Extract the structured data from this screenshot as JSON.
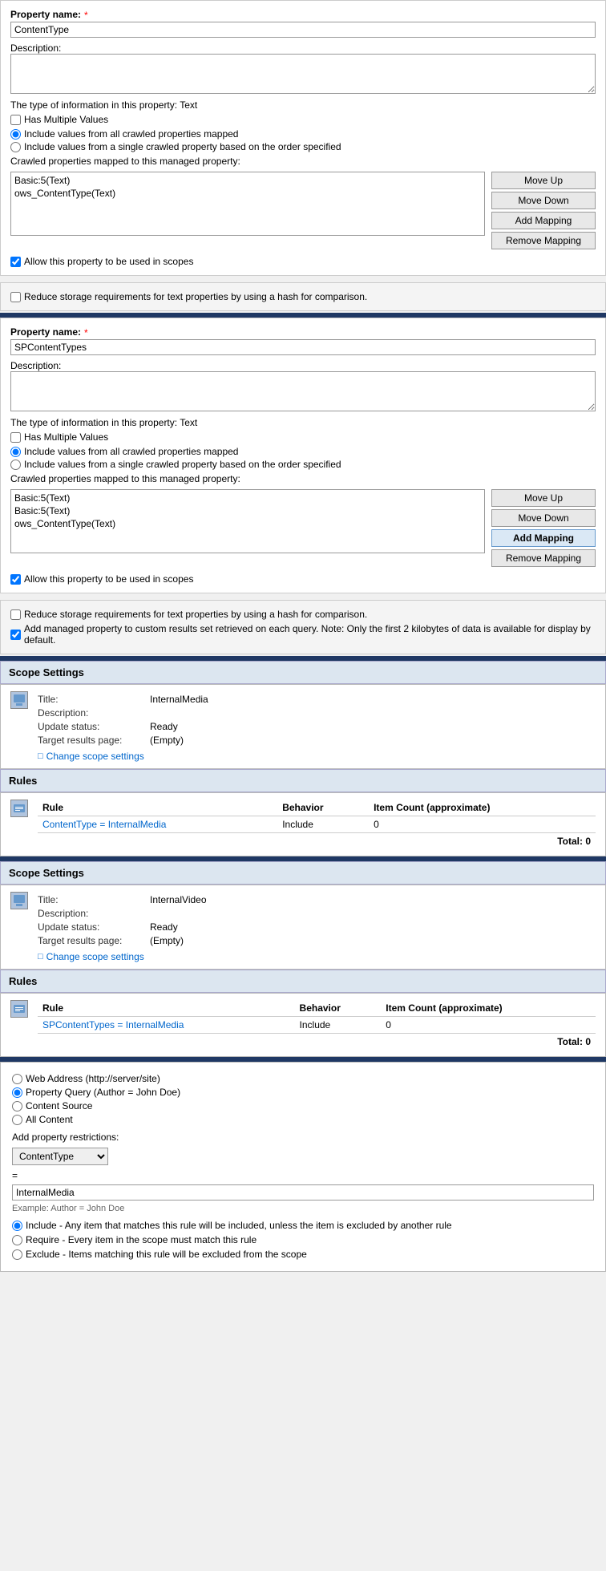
{
  "page": {
    "section1": {
      "property_name_label": "Property name:",
      "property_name_value": "ContentType",
      "description_label": "Description:",
      "type_info": "The type of information in this property: Text",
      "has_multiple_values": "Has Multiple Values",
      "radio1": "Include values from all crawled properties mapped",
      "radio2": "Include values from a single crawled property based on the order specified",
      "crawled_label": "Crawled properties mapped to this managed property:",
      "crawled_items": [
        "Basic:5(Text)",
        "ows_ContentType(Text)"
      ],
      "btn_move_up": "Move Up",
      "btn_move_down": "Move Down",
      "btn_add_mapping": "Add Mapping",
      "btn_remove_mapping": "Remove Mapping",
      "allow_scope": "Allow this property to be used in scopes",
      "reduce_storage": "Reduce storage requirements for text properties by using a hash for comparison."
    },
    "section2": {
      "property_name_label": "Property name:",
      "property_name_value": "SPContentTypes",
      "description_label": "Description:",
      "type_info": "The type of information in this property: Text",
      "has_multiple_values": "Has Multiple Values",
      "radio1": "Include values from all crawled properties mapped",
      "radio2": "Include values from a single crawled property based on the order specified",
      "crawled_label": "Crawled properties mapped to this managed property:",
      "crawled_items": [
        "Basic:5(Text)",
        "Basic:5(Text)",
        "ows_ContentType(Text)"
      ],
      "btn_move_up": "Move Up",
      "btn_move_down": "Move Down",
      "btn_add_mapping": "Add Mapping",
      "btn_remove_mapping": "Remove Mapping",
      "allow_scope": "Allow this property to be used in scopes",
      "reduce_storage1": "Reduce storage requirements for text properties by using a hash for comparison.",
      "reduce_storage2": "Add managed property to custom results set retrieved on each query. Note: Only the first 2 kilobytes of data is available for display by default."
    },
    "scope1": {
      "header": "Scope Settings",
      "title_label": "Title:",
      "title_value": "InternalMedia",
      "description_label": "Description:",
      "update_status_label": "Update status:",
      "update_status_value": "Ready",
      "target_results_label": "Target results page:",
      "target_results_value": "(Empty)",
      "change_scope": "Change scope settings"
    },
    "rules1": {
      "header": "Rules",
      "col_rule": "Rule",
      "col_behavior": "Behavior",
      "col_item_count": "Item Count",
      "col_approximate": "(approximate)",
      "rule_link": "ContentType = InternalMedia",
      "behavior": "Include",
      "item_count": "0",
      "total_label": "Total: 0"
    },
    "scope2": {
      "header": "Scope Settings",
      "title_label": "Title:",
      "title_value": "InternalVideo",
      "description_label": "Description:",
      "update_status_label": "Update status:",
      "update_status_value": "Ready",
      "target_results_label": "Target results page:",
      "target_results_value": "(Empty)",
      "change_scope": "Change scope settings"
    },
    "rules2": {
      "header": "Rules",
      "col_rule": "Rule",
      "col_behavior": "Behavior",
      "col_item_count": "Item Count",
      "col_approximate": "(approximate)",
      "rule_link": "SPContentTypes = InternalMedia",
      "behavior": "Include",
      "item_count": "0",
      "total_label": "Total: 0"
    },
    "add_rule": {
      "radio_web": "Web Address (http://server/site)",
      "radio_property": "Property Query (Author = John Doe)",
      "radio_content": "Content Source",
      "radio_all": "All Content",
      "add_property_label": "Add property restrictions:",
      "dropdown_value": "ContentType",
      "equals_sign": "=",
      "value_input": "InternalMedia",
      "example_text": "Example: Author = John Doe",
      "include_label": "Include - Any item that matches this rule will be included, unless the item is excluded by another rule",
      "require_label": "Require - Every item in the scope must match this rule",
      "exclude_label": "Exclude - Items matching this rule will be excluded from the scope"
    }
  }
}
